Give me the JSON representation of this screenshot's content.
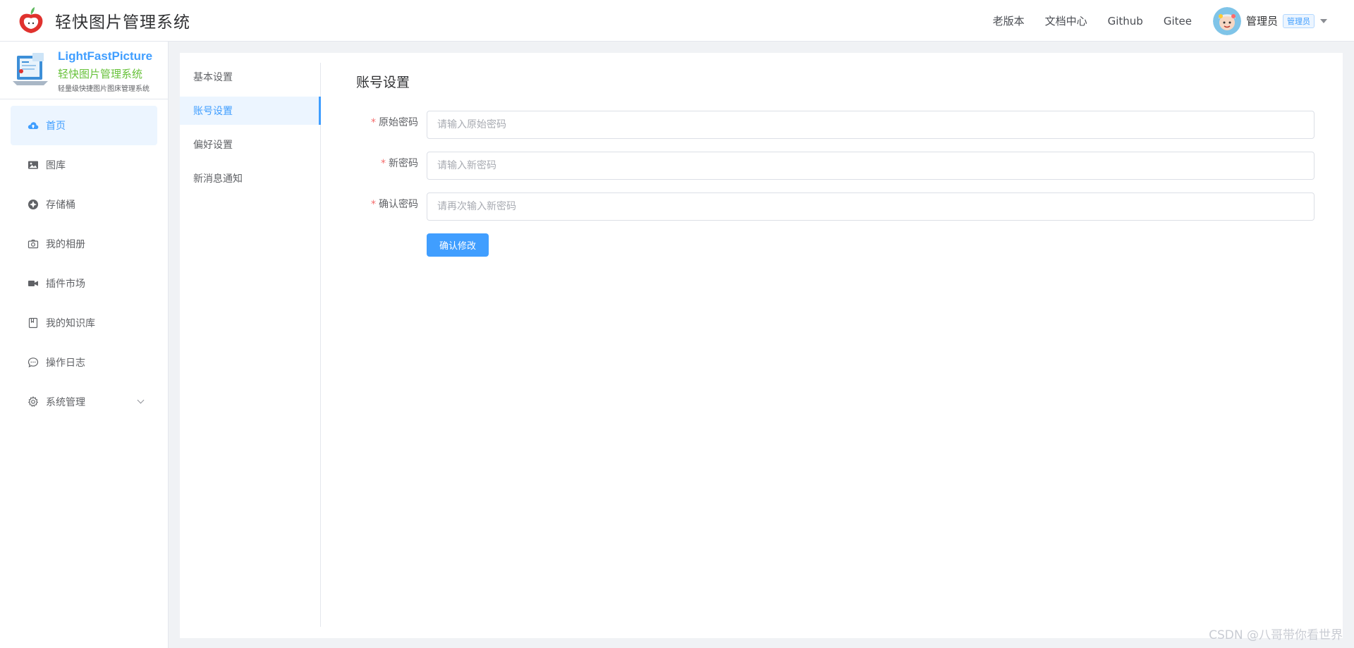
{
  "header": {
    "app_title": "轻快图片管理系统",
    "nav": [
      {
        "label": "老版本"
      },
      {
        "label": "文档中心"
      },
      {
        "label": "Github"
      },
      {
        "label": "Gitee"
      }
    ],
    "user": {
      "name": "管理员",
      "role_badge": "管理员"
    }
  },
  "brand": {
    "name_en": "LightFastPicture",
    "name_cn": "轻快图片管理系统",
    "tagline": "轻量级快捷图片图床管理系统"
  },
  "sidebar": {
    "items": [
      {
        "label": "首页",
        "icon": "cloud-upload-icon",
        "active": true
      },
      {
        "label": "图库",
        "icon": "picture-icon",
        "active": false
      },
      {
        "label": "存储桶",
        "icon": "bucket-icon",
        "active": false
      },
      {
        "label": "我的相册",
        "icon": "camera-icon",
        "active": false
      },
      {
        "label": "插件市场",
        "icon": "plugin-icon",
        "active": false
      },
      {
        "label": "我的知识库",
        "icon": "notebook-icon",
        "active": false
      },
      {
        "label": "操作日志",
        "icon": "chat-icon",
        "active": false
      },
      {
        "label": "系统管理",
        "icon": "gear-icon",
        "active": false,
        "expandable": true
      }
    ]
  },
  "settings_nav": {
    "items": [
      {
        "label": "基本设置",
        "active": false
      },
      {
        "label": "账号设置",
        "active": true
      },
      {
        "label": "偏好设置",
        "active": false
      },
      {
        "label": "新消息通知",
        "active": false
      }
    ]
  },
  "account_form": {
    "title": "账号设置",
    "fields": [
      {
        "label": "原始密码",
        "required_mark": "*",
        "placeholder": "请输入原始密码",
        "value": ""
      },
      {
        "label": "新密码",
        "required_mark": "*",
        "placeholder": "请输入新密码",
        "value": ""
      },
      {
        "label": "确认密码",
        "required_mark": "*",
        "placeholder": "请再次输入新密码",
        "value": ""
      }
    ],
    "submit_label": "确认修改"
  },
  "watermark": "CSDN @八哥带你看世界",
  "colors": {
    "primary": "#409eff",
    "brand_green": "#67c23a",
    "required": "#f56c6c"
  }
}
